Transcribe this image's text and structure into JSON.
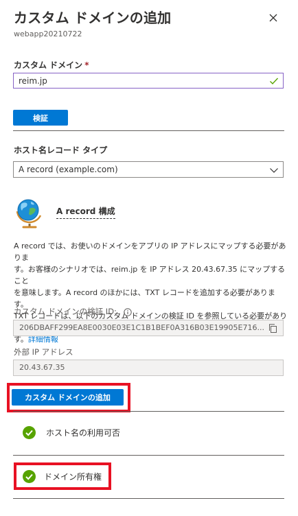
{
  "header": {
    "title": "カスタム ドメインの追加",
    "subtitle": "webapp20210722",
    "close_icon": "close-icon"
  },
  "domain": {
    "label": "カスタム ドメイン",
    "required_mark": "*",
    "value": "reim.jp",
    "valid_icon": "checkmark-icon"
  },
  "verify_button": "検証",
  "record_type": {
    "label": "ホスト名レコード タイプ",
    "selected": "A record (example.com)"
  },
  "config": {
    "icon": "globe-icon",
    "title": "A record 構成",
    "description_lines": [
      "A record では、お使いのドメインをアプリの IP アドレスにマップする必要がありま",
      "す。お客様のシナリオでは、reim.jp を IP アドレス 20.43.67.35 にマップすること",
      "を意味します。A record のほかには、TXT レコードを追加する必要があります。",
      "TXT レコードは、以下のカスタム ドメインの検証 ID を参照している必要がありま",
      "す。"
    ],
    "more_info_link": "詳細情報"
  },
  "verification_id": {
    "label": "カスタム ドメインの検証 ID:",
    "value": "206DBAFF299EA8E0030E03E1C1B1BEF0A316B03E19905E716..."
  },
  "external_ip": {
    "label": "外部 IP アドレス",
    "value": "20.43.67.35"
  },
  "add_button": "カスタム ドメインの追加",
  "checks": [
    {
      "label": "ホスト名の利用可否",
      "status": "success"
    },
    {
      "label": "ドメイン所有権",
      "status": "success"
    }
  ],
  "colors": {
    "accent": "#0078d4",
    "success": "#57a300",
    "highlight": "#e81123"
  }
}
